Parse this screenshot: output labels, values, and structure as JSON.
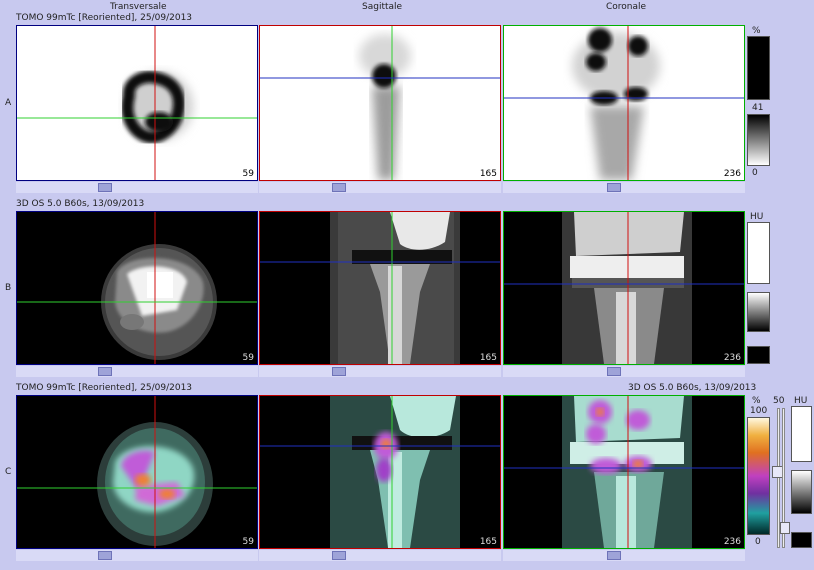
{
  "columns": [
    "Transversale",
    "Sagittale",
    "Coronale"
  ],
  "rows": [
    {
      "label": "A",
      "title_left": "TOMO 99mTc [Reoriented], 25/09/2013",
      "title_right": "",
      "slices": [
        "59",
        "165",
        "236"
      ],
      "scale": {
        "unit": "%",
        "top": "",
        "mid": "41",
        "bottom": "0"
      }
    },
    {
      "label": "B",
      "title_left": "3D  OS  5.0  B60s, 13/09/2013",
      "title_right": "",
      "slices": [
        "59",
        "165",
        "236"
      ],
      "scale": {
        "unit": "HU"
      }
    },
    {
      "label": "C",
      "title_left": "TOMO 99mTc [Reoriented], 25/09/2013",
      "title_right": "3D  OS  5.0  B60s, 13/09/2013",
      "slices": [
        "59",
        "165",
        "236"
      ],
      "scale": {
        "unit_pct": "%",
        "top": "100",
        "blend": "50",
        "bottom": "0",
        "unit_hu": "HU"
      }
    }
  ],
  "colors": {
    "background": "#c8c9ef",
    "transversal_border": "#000080",
    "sagittal_border": "#c00000",
    "coronal_border": "#00b000",
    "crosshair_red": "#d01010",
    "crosshair_green": "#30d030",
    "crosshair_blue": "#2030c0"
  }
}
